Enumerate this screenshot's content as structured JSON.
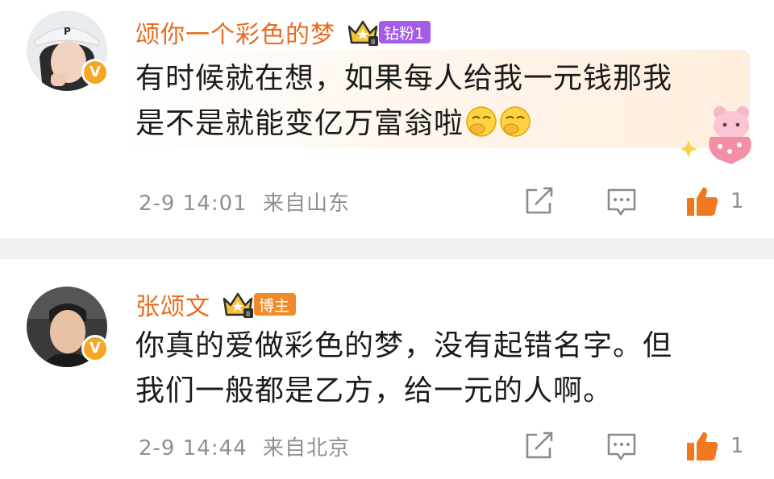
{
  "comments": [
    {
      "username": "颂你一个彩色的梦",
      "badge": "钻粉1",
      "text_line1": "有时候就在想，如果每人给我一元钱那我",
      "text_line2": "是不是就能变亿万富翁啦",
      "timestamp": "2-9 14:01",
      "location": "来自山东",
      "likes": "1",
      "verified_mark": "V"
    },
    {
      "username": "张颂文",
      "badge": "博主",
      "text_line1": "你真的爱做彩色的梦，没有起错名字。但",
      "text_line2": "我们一般都是乙方，给一元的人啊。",
      "timestamp": "2-9 14:44",
      "location": "来自北京",
      "likes": "1",
      "verified_mark": "V"
    }
  ],
  "colors": {
    "username": "#e86b1e",
    "badge_purple": "#a45be8",
    "badge_orange": "#f08a2a",
    "like_orange": "#f0781e",
    "meta_gray": "#8f8f8f"
  },
  "icons": [
    "share-icon",
    "comment-icon",
    "like-icon",
    "crown-icon",
    "verified-icon",
    "smirk-emoji-icon",
    "bear-sticker-icon"
  ]
}
